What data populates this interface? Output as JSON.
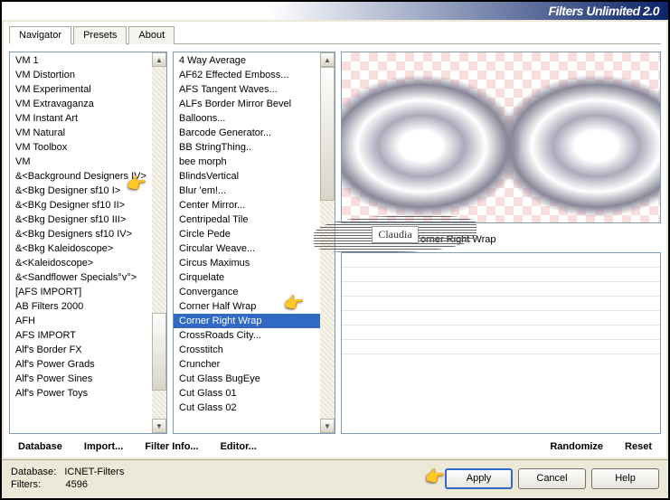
{
  "title": "Filters Unlimited 2.0",
  "tabs": [
    "Navigator",
    "Presets",
    "About"
  ],
  "activeTab": 0,
  "categories": [
    "VM 1",
    "VM Distortion",
    "VM Experimental",
    "VM Extravaganza",
    "VM Instant Art",
    "VM Natural",
    "VM Toolbox",
    "VM",
    "&<Background Designers IV>",
    "&<Bkg Designer sf10 I>",
    "&<BKg Designer sf10 II>",
    "&<Bkg Designer sf10 III>",
    "&<Bkg Designers sf10 IV>",
    "&<Bkg Kaleidoscope>",
    "&<Kaleidoscope>",
    "&<Sandflower Specials°v°>",
    "[AFS IMPORT]",
    "AB Filters 2000",
    "AFH",
    "AFS IMPORT",
    "Alf's Border FX",
    "Alf's Power Grads",
    "Alf's Power Sines",
    "Alf's Power Toys"
  ],
  "categorySel": -1,
  "filters": [
    "4 Way Average",
    "AF62 Effected Emboss...",
    "AFS Tangent Waves...",
    "ALFs Border Mirror Bevel",
    "Balloons...",
    "Barcode Generator...",
    "BB StringThing..",
    "bee morph",
    "BlindsVertical",
    "Blur 'em!...",
    "Center Mirror...",
    "Centripedal Tile",
    "Circle Pede",
    "Circular Weave...",
    "Circus Maximus",
    "Cirquelate",
    "Convergance",
    "Corner Half Wrap",
    "Corner Right Wrap",
    "CrossRoads City...",
    "Crosstitch",
    "Cruncher",
    "Cut Glass  BugEye",
    "Cut Glass 01",
    "Cut Glass 02"
  ],
  "filterSel": 18,
  "currentFilter": "Corner Right Wrap",
  "links": {
    "database": "Database",
    "import": "Import...",
    "filterinfo": "Filter Info...",
    "editor": "Editor...",
    "randomize": "Randomize",
    "reset": "Reset"
  },
  "statusDbLabel": "Database:",
  "statusDb": "ICNET-Filters",
  "statusCountLabel": "Filters:",
  "statusCount": "4596",
  "btn": {
    "apply": "Apply",
    "cancel": "Cancel",
    "help": "Help"
  },
  "watermark": "Claudia"
}
